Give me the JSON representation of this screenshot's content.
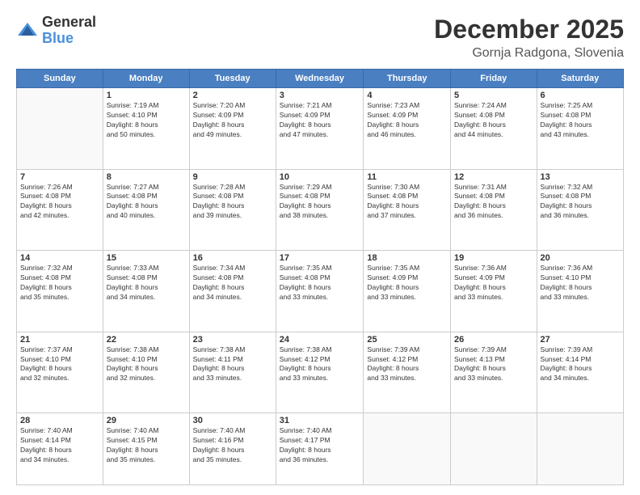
{
  "logo": {
    "general": "General",
    "blue": "Blue"
  },
  "header": {
    "month": "December 2025",
    "location": "Gornja Radgona, Slovenia"
  },
  "weekdays": [
    "Sunday",
    "Monday",
    "Tuesday",
    "Wednesday",
    "Thursday",
    "Friday",
    "Saturday"
  ],
  "weeks": [
    [
      {
        "day": "",
        "info": ""
      },
      {
        "day": "1",
        "info": "Sunrise: 7:19 AM\nSunset: 4:10 PM\nDaylight: 8 hours\nand 50 minutes."
      },
      {
        "day": "2",
        "info": "Sunrise: 7:20 AM\nSunset: 4:09 PM\nDaylight: 8 hours\nand 49 minutes."
      },
      {
        "day": "3",
        "info": "Sunrise: 7:21 AM\nSunset: 4:09 PM\nDaylight: 8 hours\nand 47 minutes."
      },
      {
        "day": "4",
        "info": "Sunrise: 7:23 AM\nSunset: 4:09 PM\nDaylight: 8 hours\nand 46 minutes."
      },
      {
        "day": "5",
        "info": "Sunrise: 7:24 AM\nSunset: 4:08 PM\nDaylight: 8 hours\nand 44 minutes."
      },
      {
        "day": "6",
        "info": "Sunrise: 7:25 AM\nSunset: 4:08 PM\nDaylight: 8 hours\nand 43 minutes."
      }
    ],
    [
      {
        "day": "7",
        "info": "Sunrise: 7:26 AM\nSunset: 4:08 PM\nDaylight: 8 hours\nand 42 minutes."
      },
      {
        "day": "8",
        "info": "Sunrise: 7:27 AM\nSunset: 4:08 PM\nDaylight: 8 hours\nand 40 minutes."
      },
      {
        "day": "9",
        "info": "Sunrise: 7:28 AM\nSunset: 4:08 PM\nDaylight: 8 hours\nand 39 minutes."
      },
      {
        "day": "10",
        "info": "Sunrise: 7:29 AM\nSunset: 4:08 PM\nDaylight: 8 hours\nand 38 minutes."
      },
      {
        "day": "11",
        "info": "Sunrise: 7:30 AM\nSunset: 4:08 PM\nDaylight: 8 hours\nand 37 minutes."
      },
      {
        "day": "12",
        "info": "Sunrise: 7:31 AM\nSunset: 4:08 PM\nDaylight: 8 hours\nand 36 minutes."
      },
      {
        "day": "13",
        "info": "Sunrise: 7:32 AM\nSunset: 4:08 PM\nDaylight: 8 hours\nand 36 minutes."
      }
    ],
    [
      {
        "day": "14",
        "info": "Sunrise: 7:32 AM\nSunset: 4:08 PM\nDaylight: 8 hours\nand 35 minutes."
      },
      {
        "day": "15",
        "info": "Sunrise: 7:33 AM\nSunset: 4:08 PM\nDaylight: 8 hours\nand 34 minutes."
      },
      {
        "day": "16",
        "info": "Sunrise: 7:34 AM\nSunset: 4:08 PM\nDaylight: 8 hours\nand 34 minutes."
      },
      {
        "day": "17",
        "info": "Sunrise: 7:35 AM\nSunset: 4:08 PM\nDaylight: 8 hours\nand 33 minutes."
      },
      {
        "day": "18",
        "info": "Sunrise: 7:35 AM\nSunset: 4:09 PM\nDaylight: 8 hours\nand 33 minutes."
      },
      {
        "day": "19",
        "info": "Sunrise: 7:36 AM\nSunset: 4:09 PM\nDaylight: 8 hours\nand 33 minutes."
      },
      {
        "day": "20",
        "info": "Sunrise: 7:36 AM\nSunset: 4:10 PM\nDaylight: 8 hours\nand 33 minutes."
      }
    ],
    [
      {
        "day": "21",
        "info": "Sunrise: 7:37 AM\nSunset: 4:10 PM\nDaylight: 8 hours\nand 32 minutes."
      },
      {
        "day": "22",
        "info": "Sunrise: 7:38 AM\nSunset: 4:10 PM\nDaylight: 8 hours\nand 32 minutes."
      },
      {
        "day": "23",
        "info": "Sunrise: 7:38 AM\nSunset: 4:11 PM\nDaylight: 8 hours\nand 33 minutes."
      },
      {
        "day": "24",
        "info": "Sunrise: 7:38 AM\nSunset: 4:12 PM\nDaylight: 8 hours\nand 33 minutes."
      },
      {
        "day": "25",
        "info": "Sunrise: 7:39 AM\nSunset: 4:12 PM\nDaylight: 8 hours\nand 33 minutes."
      },
      {
        "day": "26",
        "info": "Sunrise: 7:39 AM\nSunset: 4:13 PM\nDaylight: 8 hours\nand 33 minutes."
      },
      {
        "day": "27",
        "info": "Sunrise: 7:39 AM\nSunset: 4:14 PM\nDaylight: 8 hours\nand 34 minutes."
      }
    ],
    [
      {
        "day": "28",
        "info": "Sunrise: 7:40 AM\nSunset: 4:14 PM\nDaylight: 8 hours\nand 34 minutes."
      },
      {
        "day": "29",
        "info": "Sunrise: 7:40 AM\nSunset: 4:15 PM\nDaylight: 8 hours\nand 35 minutes."
      },
      {
        "day": "30",
        "info": "Sunrise: 7:40 AM\nSunset: 4:16 PM\nDaylight: 8 hours\nand 35 minutes."
      },
      {
        "day": "31",
        "info": "Sunrise: 7:40 AM\nSunset: 4:17 PM\nDaylight: 8 hours\nand 36 minutes."
      },
      {
        "day": "",
        "info": ""
      },
      {
        "day": "",
        "info": ""
      },
      {
        "day": "",
        "info": ""
      }
    ]
  ]
}
